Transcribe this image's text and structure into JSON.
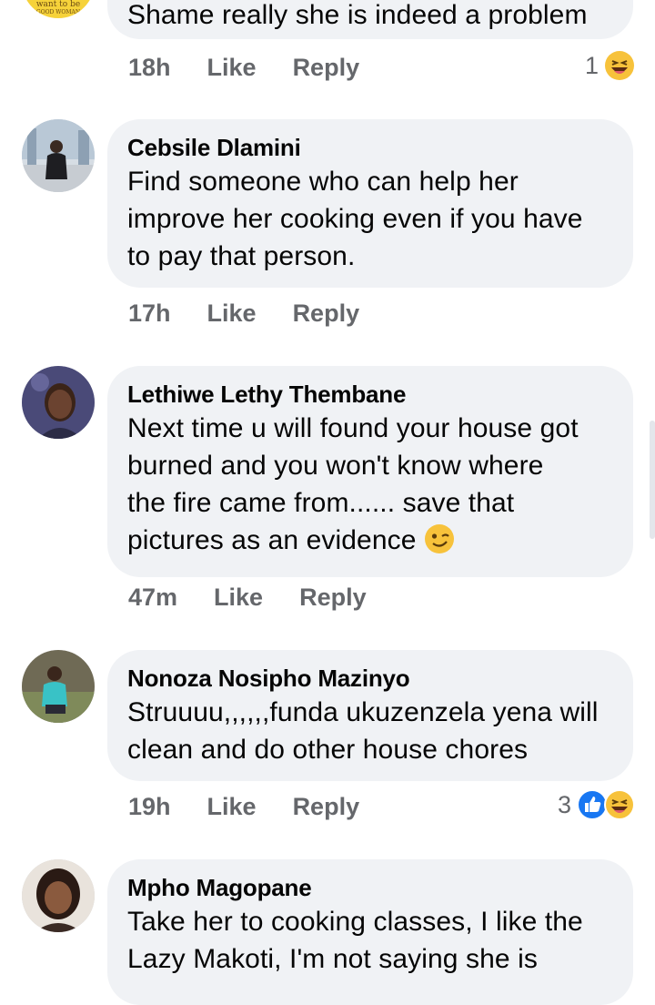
{
  "top_comment": {
    "logo_text_1": "want to be",
    "logo_text_2": "GOOD WOMAN",
    "text_last_line": "Shame really she is indeed a problem",
    "time": "18h",
    "like": "Like",
    "reply": "Reply",
    "reaction_count": "1",
    "reactions": [
      "laughing-icon"
    ]
  },
  "comments": [
    {
      "author": "Cebsile Dlamini",
      "lines": [
        "Find someone who can help her",
        "improve her cooking even if you have",
        "to pay that person."
      ],
      "time": "17h",
      "like": "Like",
      "reply": "Reply"
    },
    {
      "author": "Lethiwe Lethy Thembane",
      "lines": [
        "Next time u will found your house got",
        "burned and you won't know where",
        "the fire came from...... save that",
        "pictures as an evidence"
      ],
      "inline_emoji": "winking-face-icon",
      "time": "47m",
      "like": "Like",
      "reply": "Reply"
    },
    {
      "author": "Nonoza Nosipho Mazinyo",
      "lines": [
        "Struuuu,,,,,,funda ukuzenzela yena will",
        "clean and do other house chores"
      ],
      "time": "19h",
      "like": "Like",
      "reply": "Reply",
      "reaction_count": "3",
      "reactions": [
        "like-icon",
        "laughing-icon"
      ]
    },
    {
      "author": "Mpho Magopane",
      "lines": [
        "Take her to cooking classes, I like the",
        "Lazy Makoti, I'm not saying she is"
      ]
    }
  ],
  "colors": {
    "bubble": "#f0f2f5",
    "meta_text": "#65676b",
    "like_blue": "#1877f2",
    "emoji_yellow": "#f7c23b"
  }
}
